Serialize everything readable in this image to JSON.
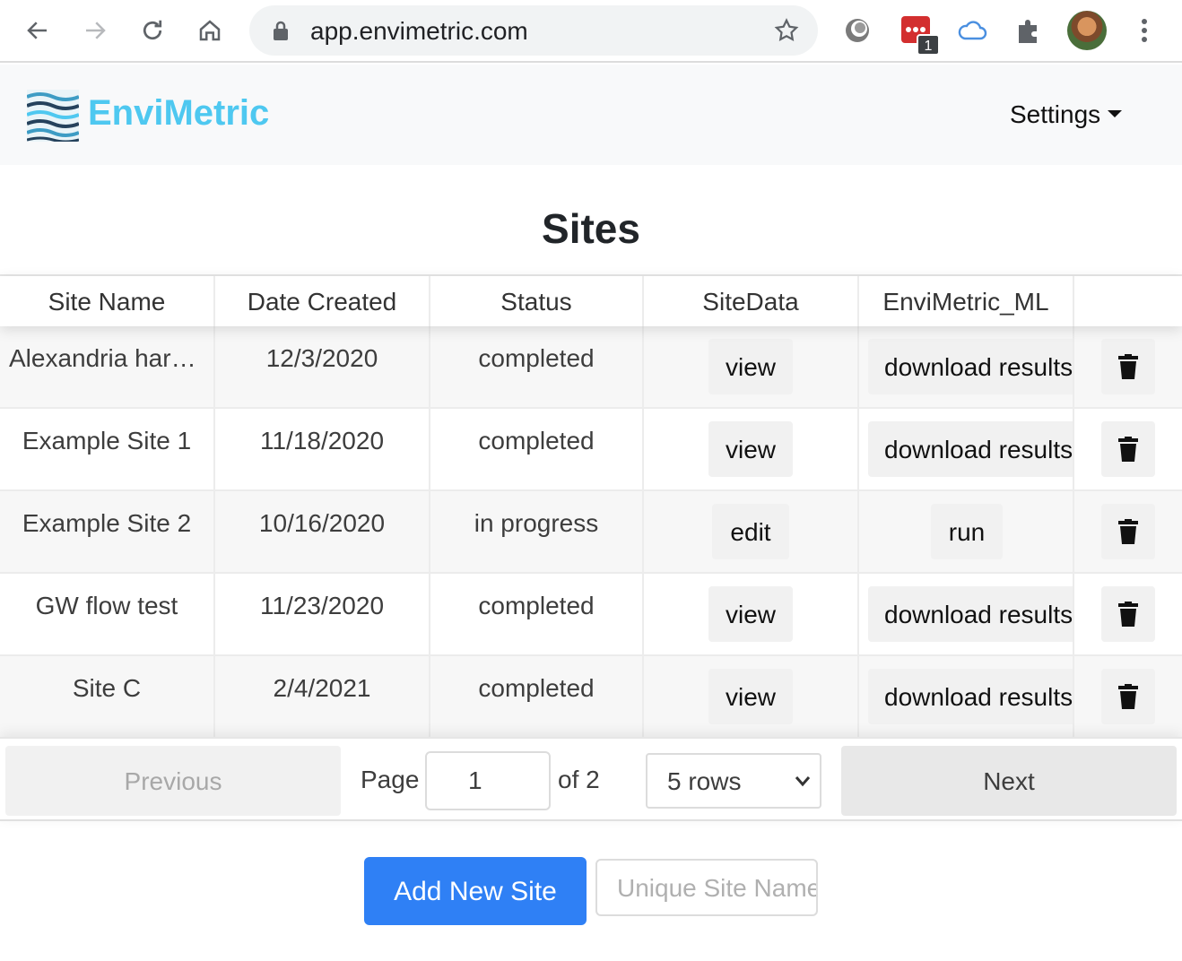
{
  "browser": {
    "url": "app.envimetric.com",
    "extension_badge": "1"
  },
  "app": {
    "brand": "EnviMetric",
    "settings_label": "Settings",
    "brand_color": "#4ec8f0"
  },
  "page": {
    "title": "Sites"
  },
  "table": {
    "columns": [
      "Site Name",
      "Date Created",
      "Status",
      "SiteData",
      "EnviMetric_ML",
      ""
    ],
    "rows": [
      {
        "name": "Alexandria harbor",
        "date": "12/3/2020",
        "status": "completed",
        "sitedata": "view",
        "ml": "download results"
      },
      {
        "name": "Example Site 1",
        "date": "11/18/2020",
        "status": "completed",
        "sitedata": "view",
        "ml": "download results"
      },
      {
        "name": "Example Site 2",
        "date": "10/16/2020",
        "status": "in progress",
        "sitedata": "edit",
        "ml": "run"
      },
      {
        "name": "GW flow test",
        "date": "11/23/2020",
        "status": "completed",
        "sitedata": "view",
        "ml": "download results"
      },
      {
        "name": "Site C",
        "date": "2/4/2021",
        "status": "completed",
        "sitedata": "view",
        "ml": "download results"
      }
    ]
  },
  "pagination": {
    "previous_label": "Previous",
    "page_label": "Page",
    "page_value": "1",
    "of_label": "of 2",
    "rows_option": "5 rows",
    "next_label": "Next"
  },
  "actions": {
    "add_label": "Add New Site",
    "site_name_placeholder": "Unique Site Name",
    "add_color": "#2f80f5"
  }
}
